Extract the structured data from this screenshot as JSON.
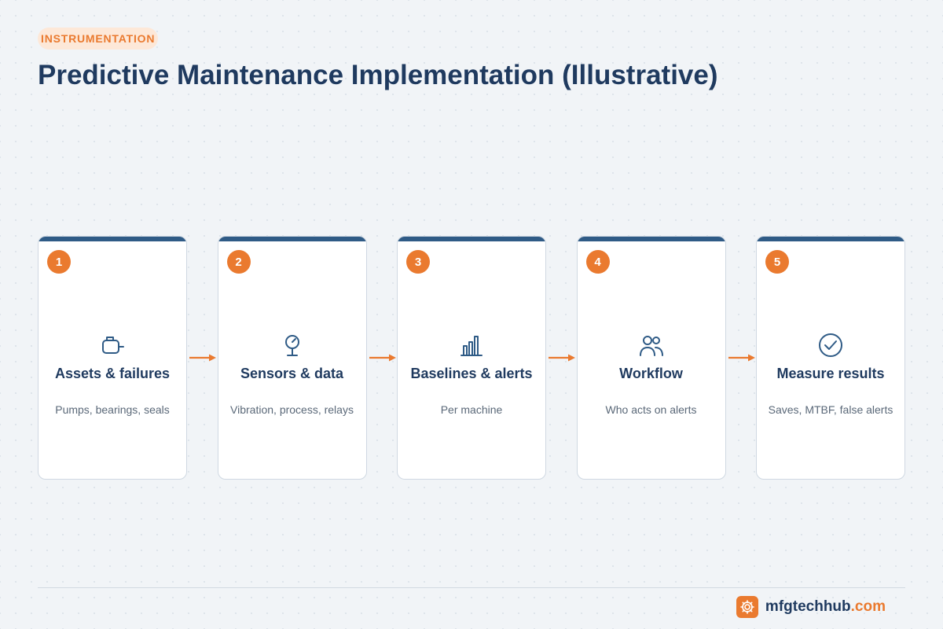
{
  "header": {
    "tag": "INSTRUMENTATION",
    "title": "Predictive Maintenance Implementation (Illustrative)"
  },
  "steps": [
    {
      "number": "1",
      "icon": "motor-icon",
      "title": "Assets & failures",
      "description": "Pumps, bearings, seals"
    },
    {
      "number": "2",
      "icon": "gauge-icon",
      "title": "Sensors & data",
      "description": "Vibration, process, relays"
    },
    {
      "number": "3",
      "icon": "bar-chart-icon",
      "title": "Baselines & alerts",
      "description": "Per machine"
    },
    {
      "number": "4",
      "icon": "users-icon",
      "title": "Workflow",
      "description": "Who acts on alerts"
    },
    {
      "number": "5",
      "icon": "check-circle-icon",
      "title": "Measure results",
      "description": "Saves, MTBF, false alerts"
    }
  ],
  "brand": {
    "icon": "gear-icon",
    "name": "mfgtechhub",
    "tld": ".com"
  },
  "colors": {
    "accent": "#ea7a2f",
    "navy": "#1f3a5f",
    "card_bar": "#2f5b86",
    "background": "#f1f4f7"
  }
}
